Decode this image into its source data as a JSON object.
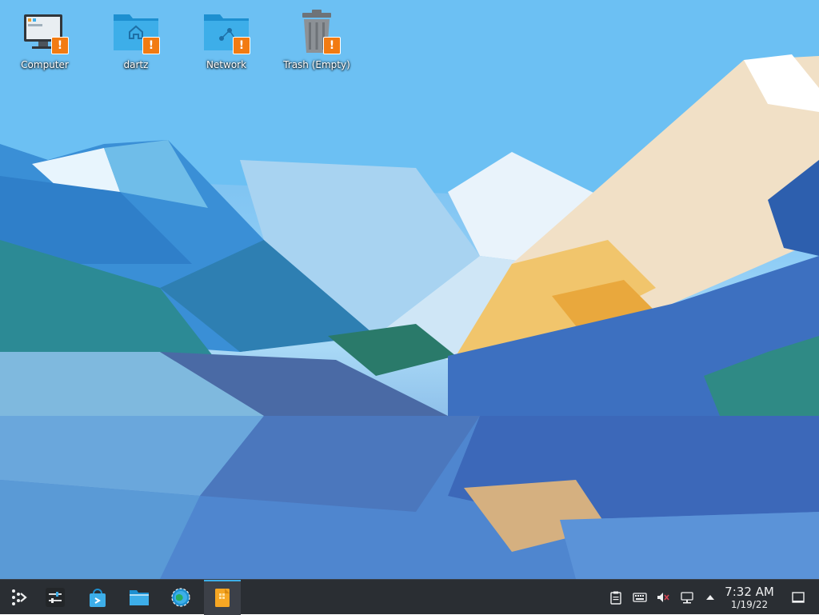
{
  "desktop": {
    "icons": [
      {
        "label": "Computer",
        "icon": "computer-icon",
        "badge": "!"
      },
      {
        "label": "dartz",
        "icon": "home-folder-icon",
        "badge": "!"
      },
      {
        "label": "Network",
        "icon": "network-folder-icon",
        "badge": "!"
      },
      {
        "label": "Trash (Empty)",
        "icon": "trash-icon",
        "badge": "!"
      }
    ]
  },
  "taskbar": {
    "launcher_icon": "kde-launcher-icon",
    "apps": [
      {
        "name": "system-settings-panel",
        "icon": "sliders-icon"
      },
      {
        "name": "discover",
        "icon": "store-bag-icon"
      },
      {
        "name": "dolphin",
        "icon": "folder-icon"
      },
      {
        "name": "settings",
        "icon": "gear-globe-icon"
      },
      {
        "name": "archive",
        "icon": "archive-icon",
        "active": true
      }
    ],
    "tray": [
      {
        "name": "clipboard",
        "icon": "clipboard-icon"
      },
      {
        "name": "keyboard",
        "icon": "keyboard-icon"
      },
      {
        "name": "volume",
        "icon": "volume-muted-icon"
      },
      {
        "name": "network",
        "icon": "network-icon"
      },
      {
        "name": "expand",
        "icon": "chevron-up-icon"
      }
    ],
    "clock": {
      "time": "7:32 AM",
      "date": "1/19/22"
    },
    "show_desktop_icon": "show-desktop-icon"
  },
  "colors": {
    "taskbar_bg": "#2a2e33",
    "badge": "#f27b12",
    "accent": "#3daee9"
  }
}
